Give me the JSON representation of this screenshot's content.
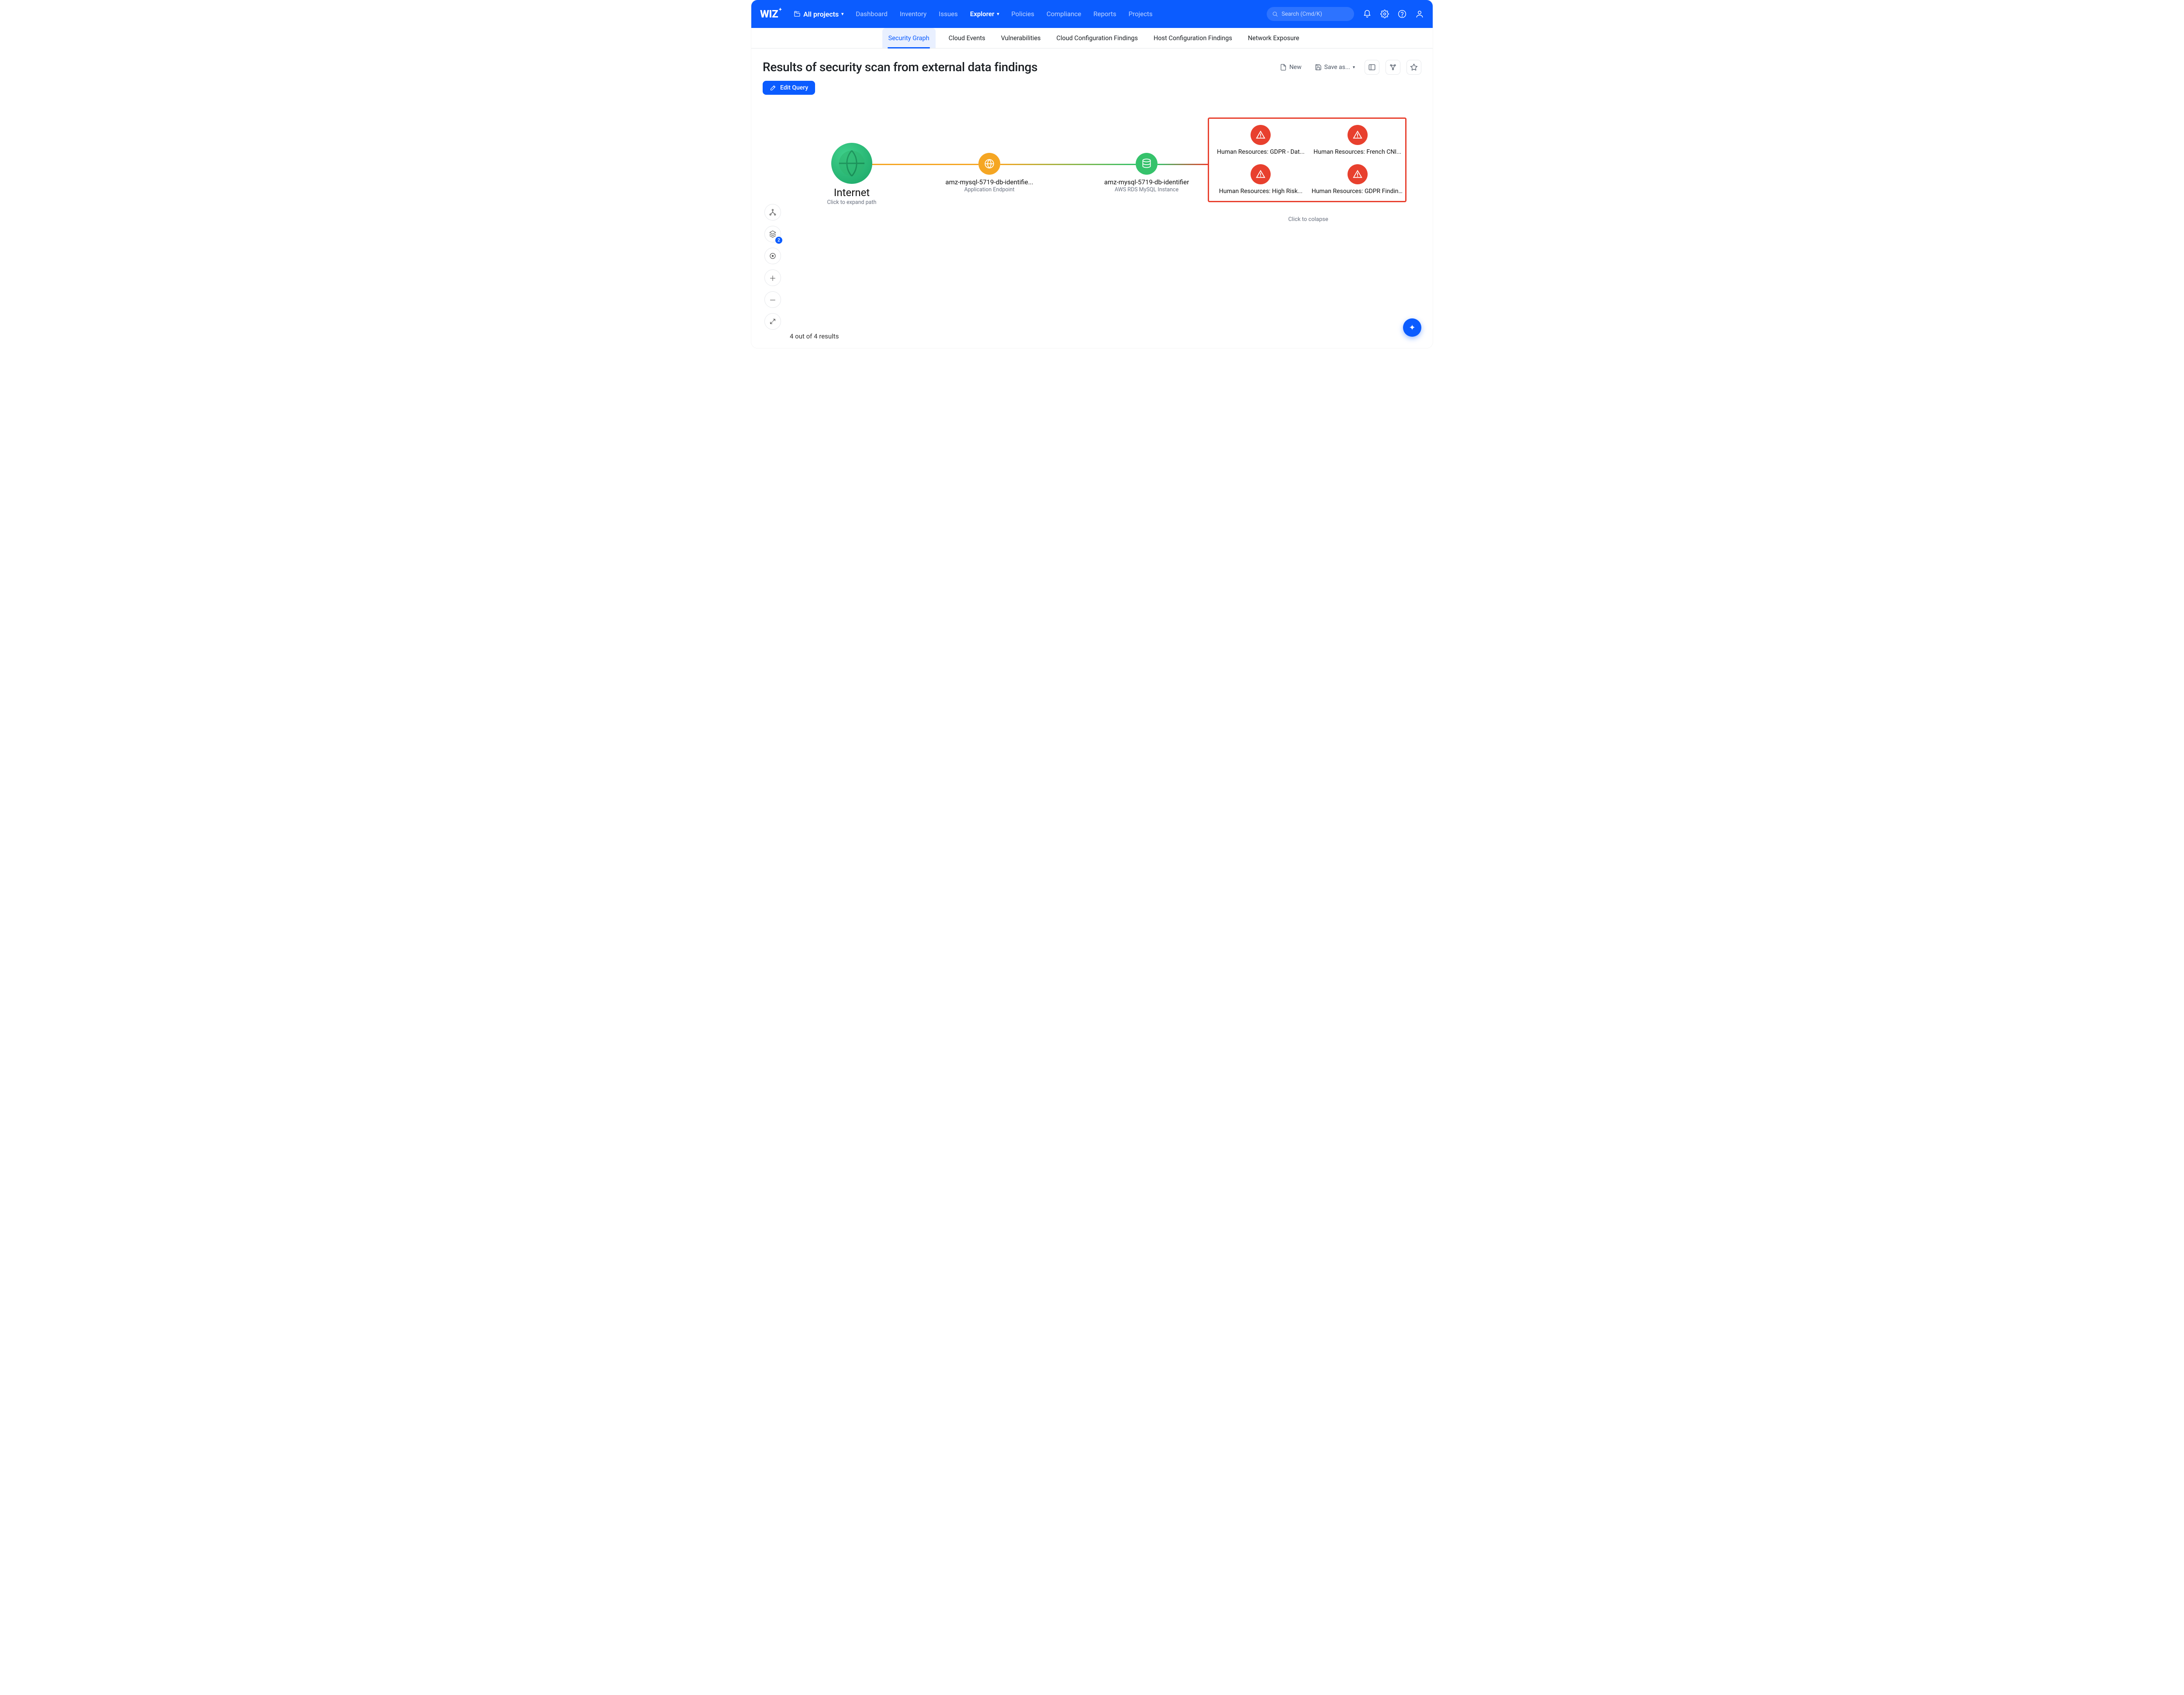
{
  "brand": "WIZ",
  "project_picker": {
    "label": "All projects"
  },
  "nav": {
    "items": [
      {
        "label": "Dashboard"
      },
      {
        "label": "Inventory"
      },
      {
        "label": "Issues"
      },
      {
        "label": "Explorer",
        "active": true,
        "dropdown": true
      },
      {
        "label": "Policies"
      },
      {
        "label": "Compliance"
      },
      {
        "label": "Reports"
      },
      {
        "label": "Projects"
      }
    ]
  },
  "search": {
    "placeholder": "Search (Cmd/K)"
  },
  "subtabs": [
    {
      "label": "Security Graph",
      "active": true
    },
    {
      "label": "Cloud Events"
    },
    {
      "label": "Vulnerabilities"
    },
    {
      "label": "Cloud Configuration Findings"
    },
    {
      "label": "Host Configuration Findings"
    },
    {
      "label": "Network Exposure"
    }
  ],
  "page": {
    "title": "Results of security scan from external data findings",
    "actions": {
      "new_label": "New",
      "save_as_label": "Save as...",
      "edit_query_label": "Edit Query"
    }
  },
  "graph": {
    "internet": {
      "title": "Internet",
      "subtitle": "Click to expand path"
    },
    "app_endpoint": {
      "title": "amz-mysql-5719-db-identifie...",
      "subtitle": "Application Endpoint"
    },
    "db_instance": {
      "title": "amz-mysql-5719-db-identifier",
      "subtitle": "AWS RDS MySQL Instance"
    },
    "findings": [
      {
        "label": "Human Resources: GDPR - Dat..."
      },
      {
        "label": "Human Resources: French CNI..."
      },
      {
        "label": "Human Resources: High Risk..."
      },
      {
        "label": "Human Resources: GDPR Findings"
      }
    ],
    "collapse_hint": "Click to colapse"
  },
  "tool_rail": {
    "layers_badge": "2"
  },
  "footer": {
    "results_text": "4 out of 4 results"
  },
  "colors": {
    "brand": "#0B5CFF",
    "danger": "#e8402e",
    "orange": "#f5a623",
    "green": "#35c26b"
  }
}
